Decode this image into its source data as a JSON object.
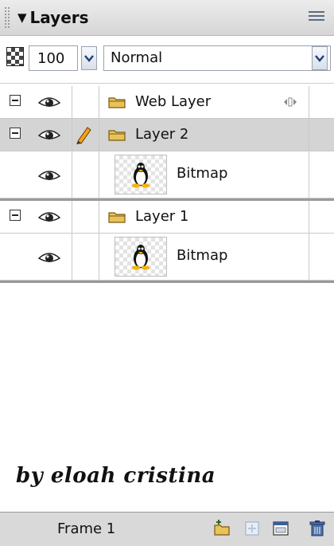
{
  "panel": {
    "title": "Layers"
  },
  "toolbar": {
    "opacity": "100",
    "blend_mode": "Normal"
  },
  "layers": [
    {
      "name": "Web Layer",
      "type": "folder-web",
      "selected": false,
      "children": []
    },
    {
      "name": "Layer 2",
      "type": "folder",
      "selected": true,
      "editing": true,
      "children": [
        {
          "name": "Bitmap"
        }
      ]
    },
    {
      "name": "Layer 1",
      "type": "folder",
      "selected": false,
      "children": [
        {
          "name": "Bitmap"
        }
      ]
    }
  ],
  "signature": "by eloah cristina",
  "status": {
    "frame_label": "Frame 1"
  },
  "colors": {
    "selection": "#d4d4d4",
    "title_bar": "#dcdcdc",
    "status_bar": "#d9d9d9"
  },
  "icons": [
    "grip-icon",
    "panel-menu-icon",
    "opacity-icon",
    "dropdown-arrow-icon",
    "eye-icon",
    "pencil-icon",
    "folder-icon",
    "tux-icon",
    "web-layer-handle-icon",
    "new-layer-icon",
    "new-sublayer-icon",
    "layer-properties-icon",
    "trash-icon"
  ]
}
